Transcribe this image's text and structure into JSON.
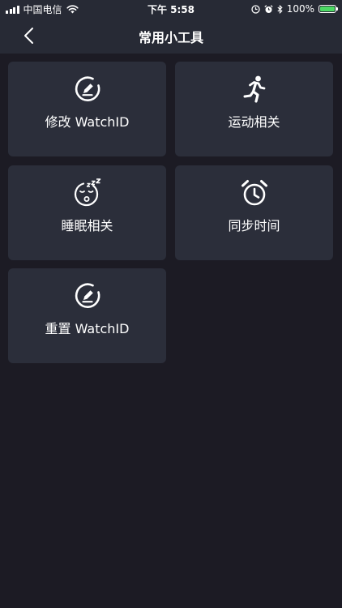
{
  "status_bar": {
    "carrier": "中国电信",
    "time": "下午 5:58",
    "battery_percent": "100%",
    "signal_bars": 4,
    "battery_level": 1.0,
    "icons": [
      "signal-icon",
      "wifi-icon",
      "location-lock-icon",
      "alarm-icon",
      "bluetooth-icon",
      "battery-charging-icon"
    ]
  },
  "nav": {
    "title": "常用小工具",
    "back_icon": "chevron-left-icon"
  },
  "tools": [
    {
      "label": "修改 WatchID",
      "icon": "edit-circle-icon"
    },
    {
      "label": "运动相关",
      "icon": "running-person-icon"
    },
    {
      "label": "睡眠相关",
      "icon": "sleeping-face-icon"
    },
    {
      "label": "同步时间",
      "icon": "alarm-clock-icon"
    },
    {
      "label": "重置 WatchID",
      "icon": "edit-circle-icon"
    }
  ],
  "colors": {
    "background": "#1c1b24",
    "bar": "#272a35",
    "card": "#2b2e3a",
    "text": "#ffffff",
    "battery_fill": "#4cd964"
  }
}
